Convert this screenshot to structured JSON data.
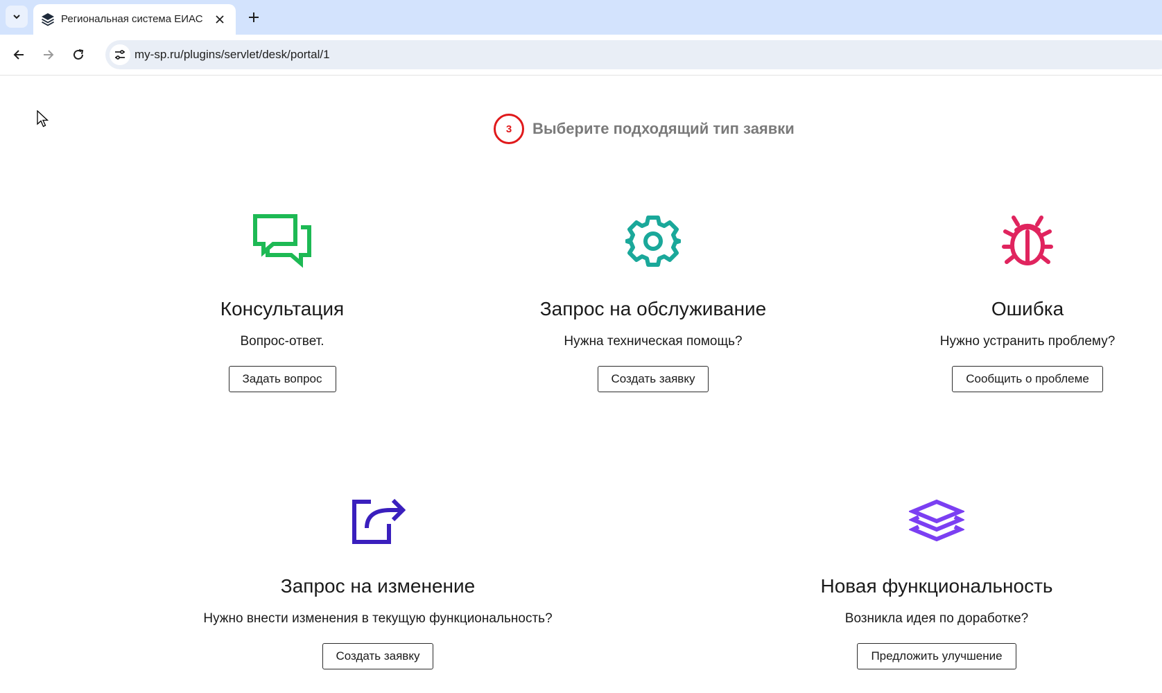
{
  "browser": {
    "tab_title": "Региональная система ЕИАС |",
    "url": "my-sp.ru/plugins/servlet/desk/portal/1"
  },
  "page": {
    "step_number": "3",
    "step_title": "Выберите подходящий тип заявки"
  },
  "cards": [
    {
      "title": "Консультация",
      "description": "Вопрос-ответ.",
      "button": "Задать вопрос",
      "icon": "chat-bubbles-icon",
      "color": "#1db954"
    },
    {
      "title": "Запрос на обслуживание",
      "description": "Нужна техническая помощь?",
      "button": "Создать заявку",
      "icon": "gear-icon",
      "color": "#1aa89a"
    },
    {
      "title": "Ошибка",
      "description": "Нужно устранить проблему?",
      "button": "Сообщить о проблеме",
      "icon": "bug-icon",
      "color": "#e0245e"
    },
    {
      "title": "Запрос на изменение",
      "description": "Нужно внести изменения в текущую функциональность?",
      "button": "Создать заявку",
      "icon": "share-arrow-icon",
      "color": "#3a1fbd"
    },
    {
      "title": "Новая функциональность",
      "description": "Возникла идея по доработке?",
      "button": "Предложить улучшение",
      "icon": "layers-icon",
      "color": "#7b3ff2"
    }
  ]
}
